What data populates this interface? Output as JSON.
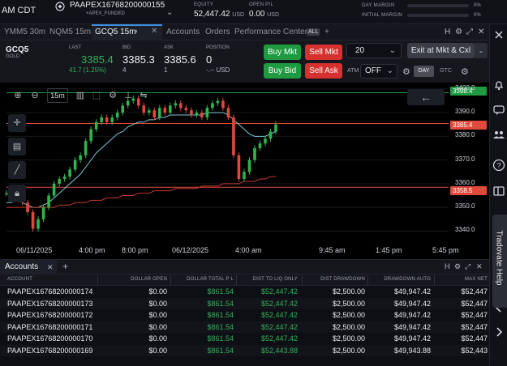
{
  "topbar": {
    "time": "AM CDT",
    "account_name": "PAAPEX16768200000155",
    "account_sub": "+APEX_FUNDED",
    "equity_label": "EQUITY",
    "equity_value": "52,447.42",
    "equity_unit": "USD",
    "openpl_label": "OPEN P/L",
    "openpl_value": "0.00",
    "openpl_unit": "USD",
    "day_margin_label": "DAY MARGIN",
    "day_margin_pct": "0%",
    "initial_margin_label": "INITIAL MARGIN",
    "initial_margin_pct": "0%"
  },
  "tabs": [
    {
      "label": "YMM5 30m"
    },
    {
      "label": "NQM5 15m"
    },
    {
      "label": "GCQ5 15m"
    },
    {
      "label": "Accounts"
    },
    {
      "label": "Orders"
    },
    {
      "label": "Performance Center"
    }
  ],
  "tab_all": "ALL",
  "tab_tools": {
    "h": "H",
    "close": "✕"
  },
  "quote": {
    "symbol": "GCQ5",
    "symbol_sub": "GOLD",
    "last_label": "LAST",
    "last_value": "3385.4",
    "last_change": "41.7 (1.25%)",
    "bid_label": "BID",
    "bid_value": "3385.3",
    "bid_size": "4",
    "ask_label": "ASK",
    "ask_value": "3385.6",
    "ask_size": "1",
    "position_label": "POSITION",
    "position_value": "0",
    "position_sub": "-.-- USD"
  },
  "buttons": {
    "buy_mkt": "Buy Mkt",
    "sell_mkt": "Sell Mkt",
    "buy_bid": "Buy Bid",
    "sell_ask": "Sell Ask",
    "qty": "20",
    "exit": "Exit at Mkt & Cxl",
    "atm_label": "ATM",
    "atm_value": "OFF",
    "day": "DAY",
    "gtc": "GTC"
  },
  "chart_toolbar": {
    "interval": "15m"
  },
  "chart_data": {
    "type": "line",
    "title": "",
    "ylim": [
      3335,
      3402
    ],
    "y_ticks": [
      3340.0,
      3350.0,
      3360.0,
      3370.0,
      3380.0,
      3390.0,
      3400.0
    ],
    "x_ticks": [
      "06/11/2025",
      "4:00 pm",
      "8:00 pm",
      "06/12/2025",
      "4:00 am",
      "9:45 am",
      "1:45 pm",
      "5:45 pm"
    ],
    "price_labels": {
      "top": "3398.4",
      "last": "3385.4",
      "bottom": "3358.5"
    },
    "series": [
      {
        "values": [
          3356,
          3357,
          3358,
          3352,
          3348,
          3341,
          3345,
          3350,
          3355,
          3360,
          3362,
          3363,
          3366,
          3370,
          3372,
          3378,
          3383,
          3386,
          3388,
          3386,
          3388,
          3390,
          3393,
          3395,
          3396,
          3393,
          3390,
          3391,
          3388,
          3392,
          3390,
          3393,
          3394,
          3392,
          3391,
          3389,
          3390,
          3388,
          3392,
          3394,
          3395,
          3392,
          3388,
          3372,
          3362,
          3365,
          3370,
          3375,
          3377,
          3379,
          3382,
          3385
        ]
      },
      {
        "values": [
          3352,
          3352,
          3353,
          3352,
          3351,
          3350,
          3350,
          3351,
          3352,
          3354,
          3356,
          3358,
          3360,
          3362,
          3364,
          3367,
          3370,
          3373,
          3375,
          3377,
          3379,
          3381,
          3382,
          3384,
          3385,
          3386,
          3386,
          3387,
          3387,
          3388,
          3388,
          3389,
          3389,
          3389,
          3389,
          3389,
          3389,
          3389,
          3390,
          3390,
          3390,
          3390,
          3389,
          3387,
          3385,
          3383,
          3381,
          3380,
          3380,
          3380,
          3381,
          3382
        ]
      },
      {
        "values": [
          3350,
          3350,
          3350,
          3350,
          3350,
          3350,
          3350,
          3350,
          3350,
          3350,
          3351,
          3351,
          3351,
          3352,
          3352,
          3352,
          3353,
          3353,
          3353,
          3354,
          3354,
          3354,
          3355,
          3355,
          3355,
          3356,
          3356,
          3356,
          3357,
          3357,
          3357,
          3357,
          3358,
          3358,
          3358,
          3358,
          3358,
          3359,
          3359,
          3359,
          3359,
          3360,
          3360,
          3360,
          3360,
          3361,
          3361,
          3361,
          3362,
          3362,
          3363,
          3363
        ]
      }
    ],
    "hlines": [
      {
        "value": 3398.4,
        "color": "#1f9a40"
      },
      {
        "value": 3385.4,
        "color": "#e04a3c"
      },
      {
        "value": 3358.5,
        "color": "#e04a3c"
      }
    ]
  },
  "accounts_panel": {
    "tab_label": "Accounts",
    "tools": {
      "h": "H",
      "close": "✕"
    },
    "columns": [
      "ACCOUNT",
      "DOLLAR OPEN",
      "DOLLAR TOTAL P L",
      "DIST TO LIQ ONLY",
      "DIST DRAWDOWN",
      "DRAWDOWN AUTO",
      "MAX NET"
    ],
    "rows": [
      {
        "account": "PAAPEX16768200000174",
        "dollar_open": "$0.00",
        "total_pl": "$861.54",
        "dist_liq": "$52,447.42",
        "dist_drawdown": "$2,500.00",
        "drawdown_auto": "$49,947.42",
        "max_net": "$52,447"
      },
      {
        "account": "PAAPEX16768200000173",
        "dollar_open": "$0.00",
        "total_pl": "$861.54",
        "dist_liq": "$52,447.42",
        "dist_drawdown": "$2,500.00",
        "drawdown_auto": "$49,947.42",
        "max_net": "$52,447"
      },
      {
        "account": "PAAPEX16768200000172",
        "dollar_open": "$0.00",
        "total_pl": "$861.54",
        "dist_liq": "$52,447.42",
        "dist_drawdown": "$2,500.00",
        "drawdown_auto": "$49,947.42",
        "max_net": "$52,447"
      },
      {
        "account": "PAAPEX16768200000171",
        "dollar_open": "$0.00",
        "total_pl": "$861.54",
        "dist_liq": "$52,447.42",
        "dist_drawdown": "$2,500.00",
        "drawdown_auto": "$49,947.42",
        "max_net": "$52,447"
      },
      {
        "account": "PAAPEX16768200000170",
        "dollar_open": "$0.00",
        "total_pl": "$861.54",
        "dist_liq": "$52,447.42",
        "dist_drawdown": "$2,500.00",
        "drawdown_auto": "$49,947.42",
        "max_net": "$52,447"
      },
      {
        "account": "PAAPEX16768200000169",
        "dollar_open": "$0.00",
        "total_pl": "$861.54",
        "dist_liq": "$52,443.88",
        "dist_drawdown": "$2,500.00",
        "drawdown_auto": "$49,943.88",
        "max_net": "$52,443"
      }
    ]
  },
  "help_tab": "Tradovate Help",
  "colors": {
    "accent": "#3d8fe0",
    "buy": "#1f9a40",
    "sell": "#d6312f",
    "profit": "#33b05a"
  }
}
